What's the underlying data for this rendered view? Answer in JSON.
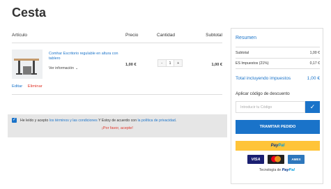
{
  "page": {
    "title": "Cesta"
  },
  "cart": {
    "headers": {
      "item": "Artículo",
      "price": "Precio",
      "quantity": "Cantidad",
      "subtotal": "Subtotal"
    },
    "items": [
      {
        "name": "Comhar Escritorio regulable en altura con tablero",
        "more_info": "Ver información",
        "price": "1,00 €",
        "quantity": "1",
        "subtotal": "1,00 €"
      }
    ],
    "actions": {
      "edit": "Editar",
      "remove": "Eliminar"
    }
  },
  "consent": {
    "prefix": "He leído y acepto ",
    "terms_link": "los términos y las condiciones",
    "middle": " Y Estoy de acuerdo con ",
    "privacy_link": "la política de privacidad",
    "suffix": ".",
    "warning": "¡Por favor, acepte!",
    "checked": true
  },
  "summary": {
    "title": "Resumen",
    "subtotal_label": "Subtotal",
    "subtotal_value": "1,00 €",
    "tax_label": "ES Impuestos (21%)",
    "tax_value": "0,17 €",
    "total_label": "Total incluyendo impuestos",
    "total_value": "1,00 €",
    "discount_label": "Aplicar código de descuento",
    "discount_placeholder": "Introducir tu Código",
    "checkout_label": "TRAMITAR PEDIDO",
    "paypal_brand_part1": "Pay",
    "paypal_brand_part2": "Pal",
    "cards": [
      "VISA",
      "mastercard",
      "AMEX"
    ],
    "tech_label": "Tecnología de "
  },
  "colors": {
    "accent": "#1a73c9",
    "danger": "#e0362b",
    "paypal_yellow": "#ffc439"
  }
}
